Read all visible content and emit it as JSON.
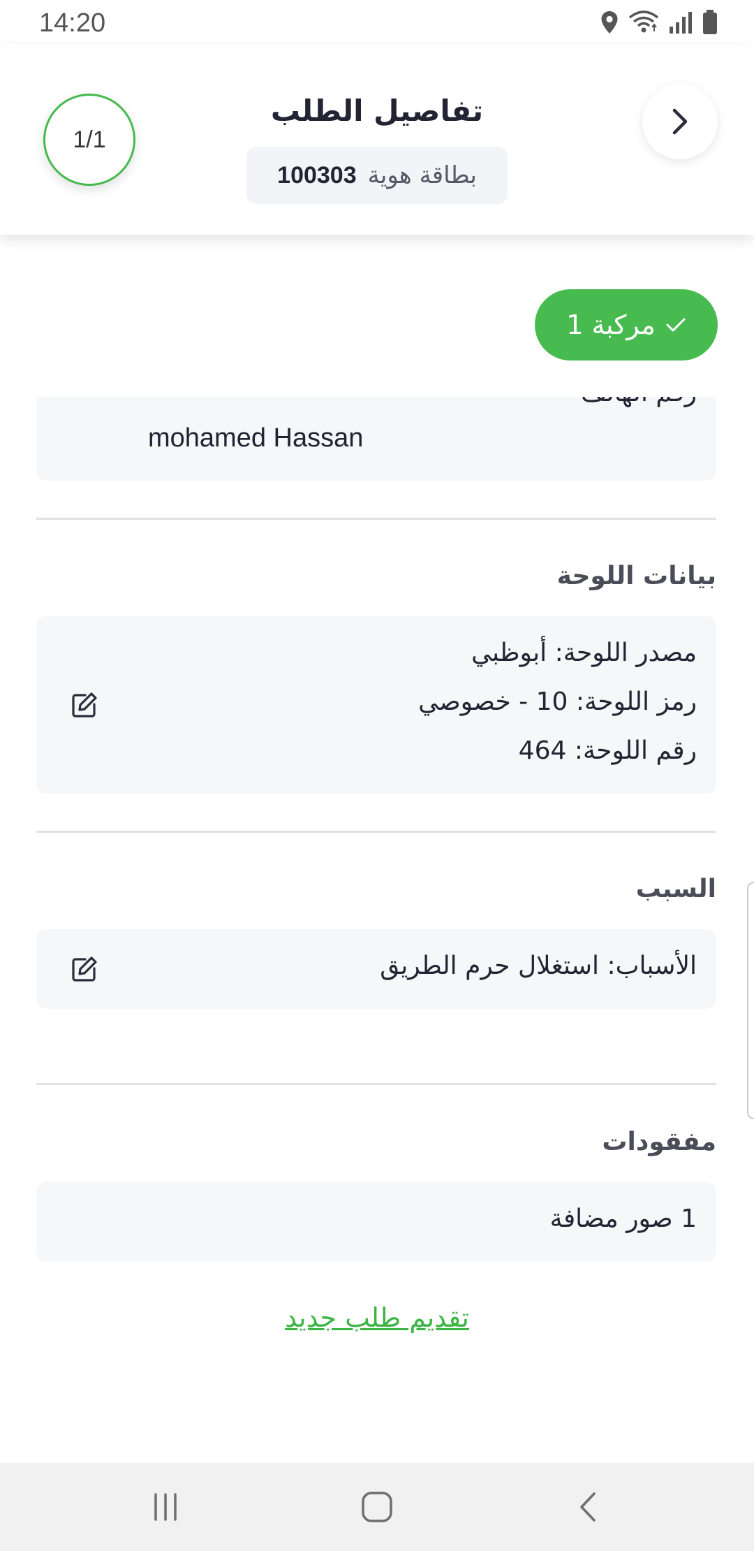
{
  "status_bar": {
    "time": "14:20",
    "icons": [
      "location-icon",
      "wifi-icon",
      "signal-icon",
      "battery-icon"
    ]
  },
  "header": {
    "title": "تفاصيل الطلب",
    "counter": "1/1",
    "id_label": "بطاقة هوية",
    "id_value": "100303"
  },
  "vehicle_tab": {
    "label": "مركبة 1"
  },
  "owner": {
    "name": "mohamed Hassan",
    "cut_label": "رقم الهاتف"
  },
  "plate_section": {
    "title": "بيانات اللوحة",
    "source": "مصدر اللوحة: أبوظبي",
    "code": "رمز اللوحة: 10 - خصوصي",
    "number": "رقم اللوحة: 464"
  },
  "reason_section": {
    "title": "السبب",
    "reasons": "الأسباب: استغلال حرم الطريق"
  },
  "lost_section": {
    "title": "مفقودات",
    "photos": "1 صور مضافة"
  },
  "actions": {
    "new_request": "تقديم طلب جديد"
  },
  "colors": {
    "accent": "#48bb50",
    "card_bg": "#f6f7f9",
    "text": "#222433"
  }
}
